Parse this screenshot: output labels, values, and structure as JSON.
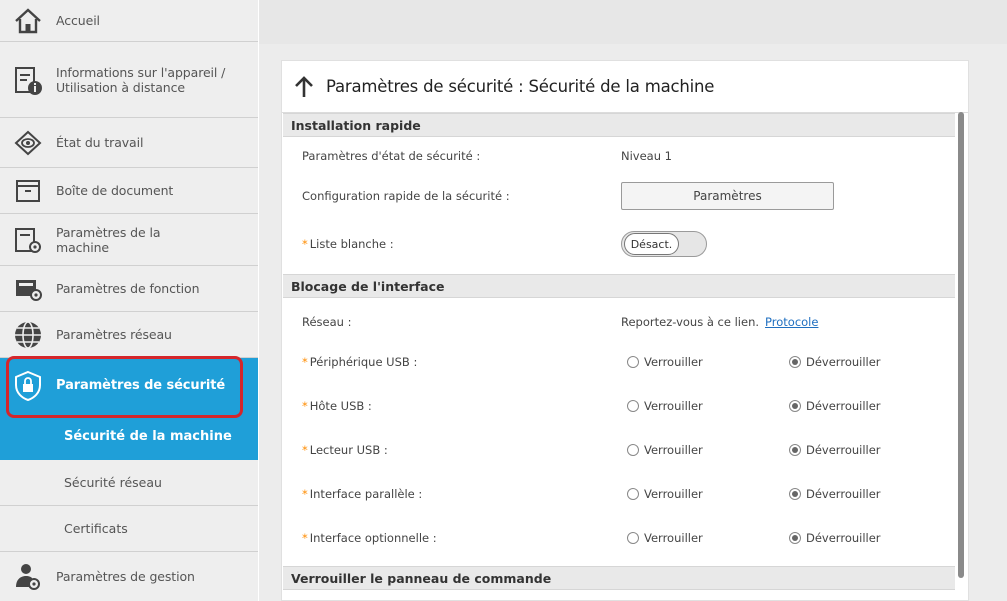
{
  "sidebar": {
    "items": [
      {
        "label": "Accueil",
        "icon": "home-icon"
      },
      {
        "label": "Informations sur l'appareil / Utilisation à distance",
        "icon": "device-info-icon"
      },
      {
        "label": "État du travail",
        "icon": "job-status-icon"
      },
      {
        "label": "Boîte de document",
        "icon": "document-box-icon"
      },
      {
        "label": "Paramètres de la machine",
        "icon": "machine-settings-icon"
      },
      {
        "label": "Paramètres de fonction",
        "icon": "function-settings-icon"
      },
      {
        "label": "Paramètres réseau",
        "icon": "network-globe-icon"
      },
      {
        "label": "Paramètres de sécurité",
        "icon": "security-shield-icon"
      },
      {
        "label": "Sécurité de la machine"
      },
      {
        "label": "Sécurité réseau"
      },
      {
        "label": "Certificats"
      },
      {
        "label": "Paramètres de gestion",
        "icon": "management-user-icon"
      }
    ]
  },
  "panel": {
    "title": "Paramètres de sécurité : Sécurité de la machine"
  },
  "sections": {
    "quick": {
      "title": "Installation rapide",
      "security_level_label": "Paramètres d'état de sécurité :",
      "security_level_value": "Niveau 1",
      "quick_config_label": "Configuration rapide de la sécurité :",
      "quick_config_button": "Paramètres",
      "whitelist_label": "Liste blanche :",
      "whitelist_toggle": "Désact."
    },
    "interface": {
      "title": "Blocage de l'interface",
      "network_label": "Réseau :",
      "network_value": "Reportez-vous à ce lien.",
      "network_link": "Protocole",
      "lock_label": "Verrouiller",
      "unlock_label": "Déverrouiller",
      "rows": [
        {
          "label": "Périphérique USB :",
          "selected": "Déverrouiller"
        },
        {
          "label": "Hôte USB :",
          "selected": "Déverrouiller"
        },
        {
          "label": "Lecteur USB :",
          "selected": "Déverrouiller"
        },
        {
          "label": "Interface parallèle :",
          "selected": "Déverrouiller"
        },
        {
          "label": "Interface optionnelle :",
          "selected": "Déverrouiller"
        }
      ]
    },
    "panel_lock": {
      "title": "Verrouiller le panneau de commande"
    }
  },
  "colors": {
    "accent": "#1f9fd8",
    "highlight": "#d4262b",
    "required_star": "#ff8c00",
    "link": "#1f6fc0"
  }
}
